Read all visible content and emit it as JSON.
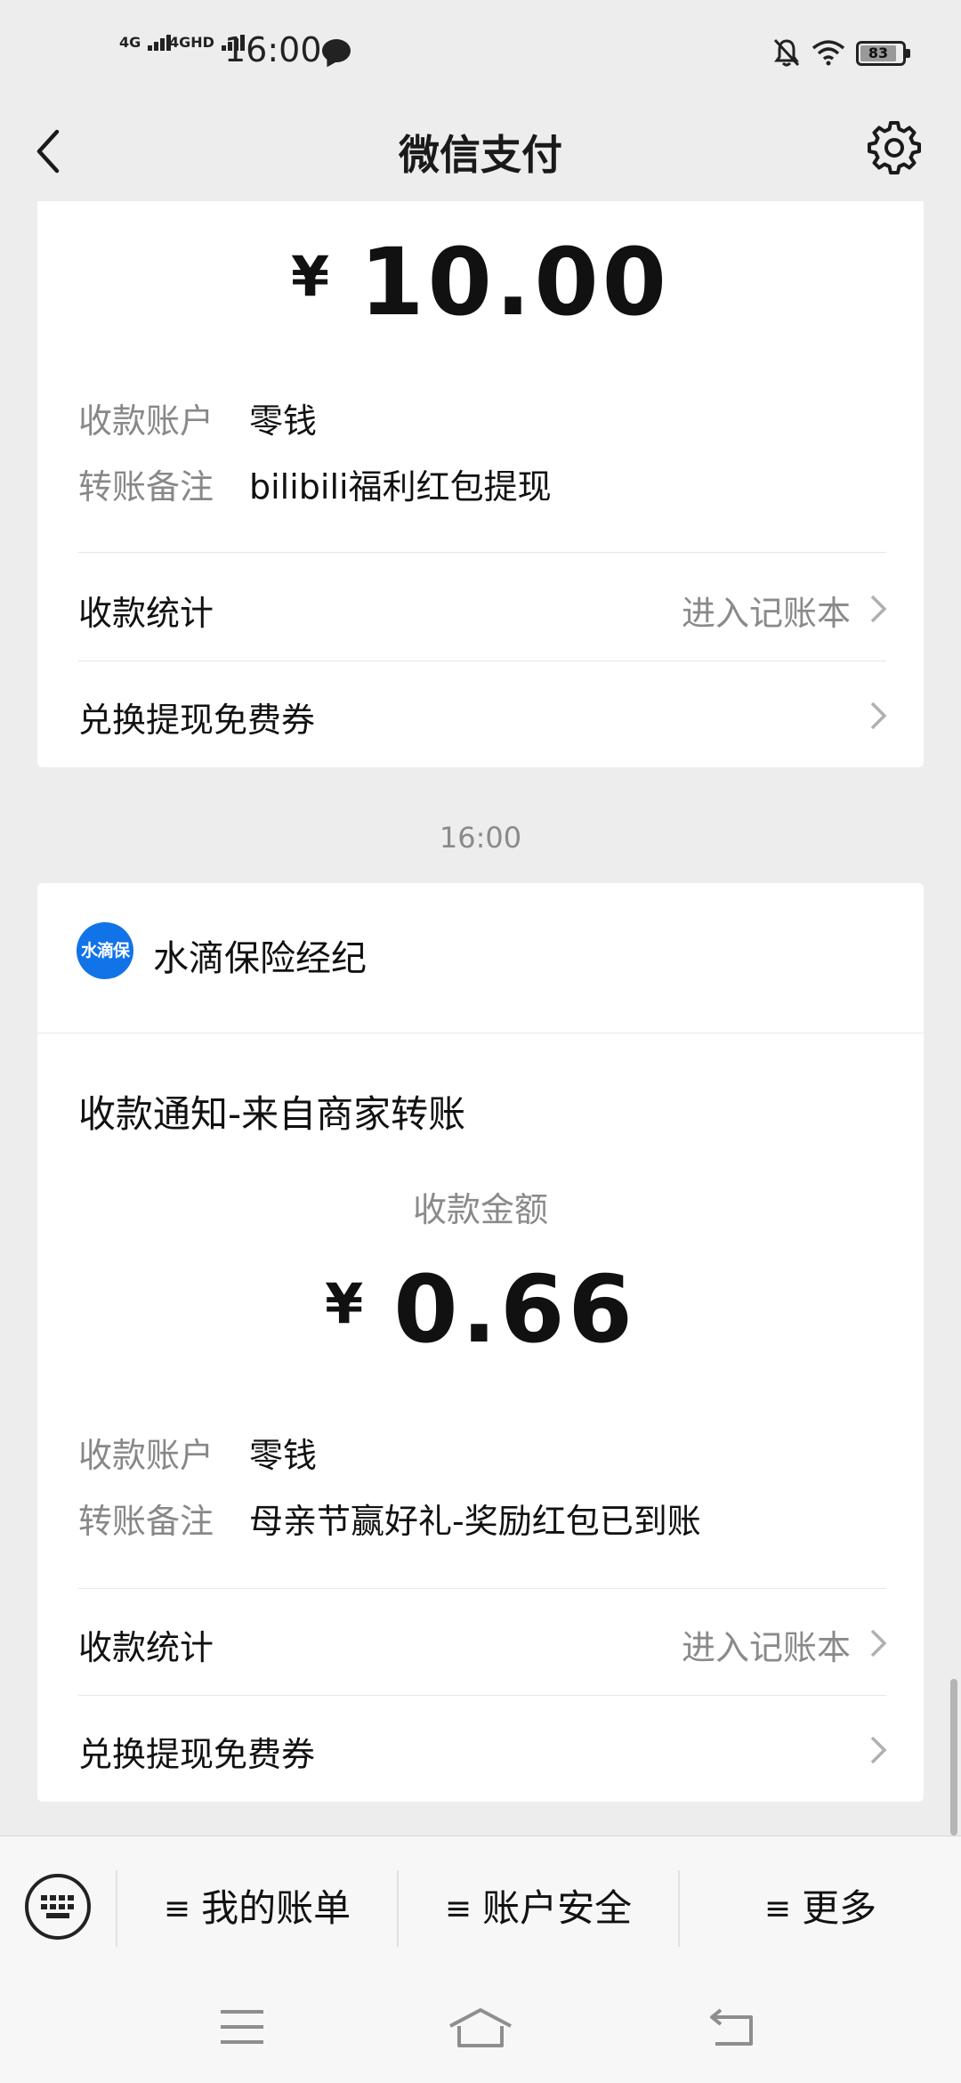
{
  "status_bar": {
    "signal1": "4G",
    "signal2": "4GHD",
    "time": "16:00",
    "battery": "83"
  },
  "nav": {
    "title": "微信支付"
  },
  "card1": {
    "currency": "¥",
    "amount": "10.00",
    "account_label": "收款账户",
    "account_value": "零钱",
    "remark_label": "转账备注",
    "remark_value": "bilibili福利红包提现",
    "stats_label": "收款统计",
    "stats_hint": "进入记账本",
    "coupon_label": "兑换提现免费券"
  },
  "time_separator": "16:00",
  "card2": {
    "merchant_logo_text": "水滴保",
    "merchant_name": "水滴保险经纪",
    "notice_title": "收款通知-来自商家转账",
    "amount_label": "收款金额",
    "currency": "¥",
    "amount": "0.66",
    "account_label": "收款账户",
    "account_value": "零钱",
    "remark_label": "转账备注",
    "remark_value": "母亲节赢好礼-奖励红包已到账",
    "stats_label": "收款统计",
    "stats_hint": "进入记账本",
    "coupon_label": "兑换提现免费券"
  },
  "bottom_menu": {
    "menu_glyph": "≡",
    "items": [
      {
        "label": "我的账单"
      },
      {
        "label": "账户安全"
      },
      {
        "label": "更多"
      }
    ]
  }
}
